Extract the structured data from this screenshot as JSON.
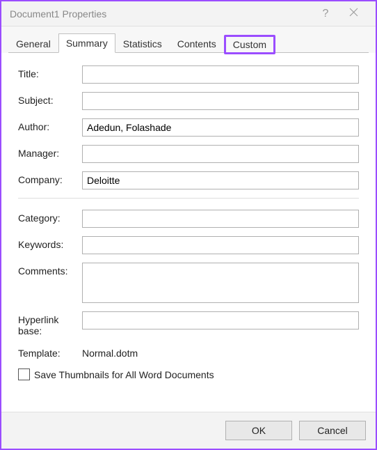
{
  "titlebar": {
    "title": "Document1 Properties",
    "help": "?"
  },
  "tabs": {
    "general": "General",
    "summary": "Summary",
    "statistics": "Statistics",
    "contents": "Contents",
    "custom": "Custom"
  },
  "form": {
    "title_label": "Title:",
    "title_value": "",
    "subject_label": "Subject:",
    "subject_value": "",
    "author_label": "Author:",
    "author_value": "Adedun, Folashade",
    "manager_label": "Manager:",
    "manager_value": "",
    "company_label": "Company:",
    "company_value": "Deloitte",
    "category_label": "Category:",
    "category_value": "",
    "keywords_label": "Keywords:",
    "keywords_value": "",
    "comments_label": "Comments:",
    "comments_value": "",
    "hyperlink_label": "Hyperlink base:",
    "hyperlink_value": "",
    "template_label": "Template:",
    "template_value": "Normal.dotm"
  },
  "checkbox": {
    "label": "Save Thumbnails for All Word Documents"
  },
  "buttons": {
    "ok": "OK",
    "cancel": "Cancel"
  }
}
